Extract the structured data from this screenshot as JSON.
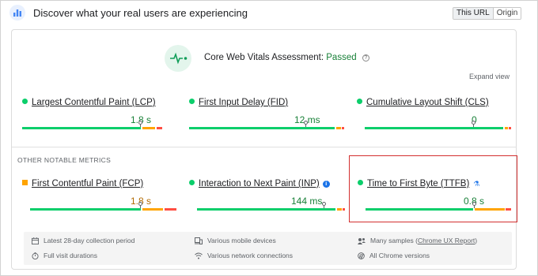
{
  "header": {
    "title": "Discover what your real users are experiencing",
    "toggle": [
      "This URL",
      "Origin"
    ]
  },
  "assessment": {
    "label": "Core Web Vitals Assessment:",
    "status": "Passed",
    "expand": "Expand view"
  },
  "core_metrics": [
    {
      "name": "Largest Contentful Paint (LCP)",
      "value": "1.8 s",
      "pct": 0.72
    },
    {
      "name": "First Input Delay (FID)",
      "value": "12 ms",
      "pct": 0.74
    },
    {
      "name": "Cumulative Layout Shift (CLS)",
      "value": "0",
      "pct": 0.74
    }
  ],
  "other_label": "OTHER NOTABLE METRICS",
  "other_metrics": [
    {
      "name": "First Contentful Paint (FCP)",
      "value": "1.8 s",
      "pct": 0.75
    },
    {
      "name": "Interaction to Next Paint (INP)",
      "value": "144 ms",
      "pct": 0.85
    },
    {
      "name": "Time to First Byte (TTFB)",
      "value": "0.8 s",
      "pct": 0.73
    }
  ],
  "footer": {
    "collection": "Latest 28-day collection period",
    "devices": "Various mobile devices",
    "samples_prefix": "Many samples (",
    "samples_link": "Chrome UX Report",
    "samples_suffix": ")",
    "durations": "Full visit durations",
    "network": "Various network connections",
    "versions": "All Chrome versions"
  },
  "colors": {
    "good": "#0cce6b",
    "needs_improvement": "#ffa400",
    "poor": "#ff4e42",
    "accent": "#1a73e8",
    "highlight": "#d32f2f"
  }
}
